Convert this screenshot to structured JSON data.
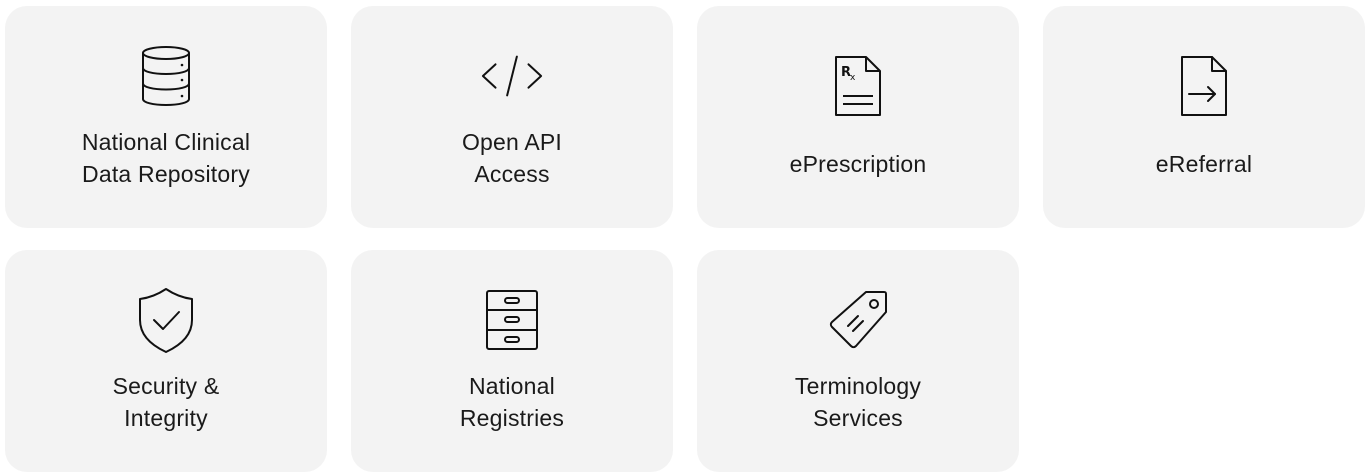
{
  "tiles": [
    {
      "label": "National Clinical\nData Repository",
      "icon": "database-icon"
    },
    {
      "label": "Open API\nAccess",
      "icon": "code-icon"
    },
    {
      "label": "ePrescription",
      "icon": "prescription-icon"
    },
    {
      "label": "eReferral",
      "icon": "referral-document-icon"
    },
    {
      "label": "Security &\nIntegrity",
      "icon": "shield-check-icon"
    },
    {
      "label": "National\nRegistries",
      "icon": "filing-cabinet-icon"
    },
    {
      "label": "Terminology\nServices",
      "icon": "tag-icon"
    }
  ],
  "colors": {
    "tile_background": "#f3f3f3",
    "text": "#1a1a1a",
    "icon_stroke": "#111111"
  }
}
